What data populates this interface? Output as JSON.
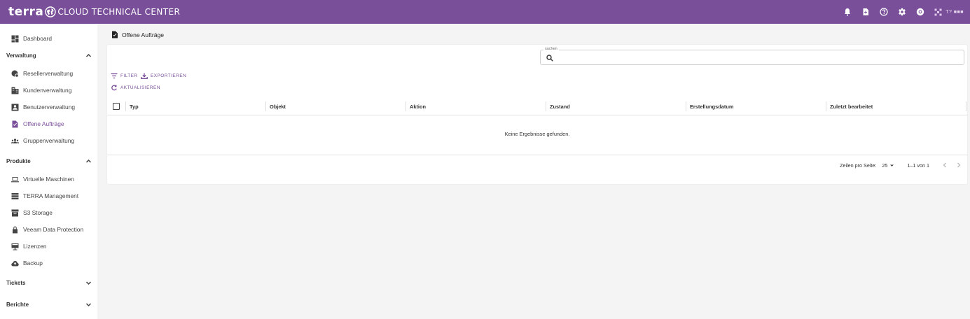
{
  "app": {
    "brand_word": "terra",
    "brand_sub": "CLOUD TECHNICAL CENTER",
    "user_name": "T? ■■■"
  },
  "colors": {
    "accent": "#7a4f9a",
    "background": "#f4f4f4"
  },
  "topbar_icons": [
    "bell-icon",
    "document-icon",
    "help-icon",
    "settings-icon",
    "support-icon",
    "avatar"
  ],
  "sidebar": {
    "dashboard": "Dashboard",
    "verwaltung": {
      "label": "Verwaltung",
      "items": [
        "Resellerverwaltung",
        "Kundenverwaltung",
        "Benutzerverwaltung",
        "Offene Aufträge",
        "Gruppenverwaltung"
      ]
    },
    "produkte": {
      "label": "Produkte",
      "items": [
        "Virtuelle Maschinen",
        "TERRA Management",
        "S3 Storage",
        "Veeam Data Protection",
        "Lizenzen",
        "Backup"
      ]
    },
    "tickets": {
      "label": "Tickets"
    },
    "berichte": {
      "label": "Berichte"
    }
  },
  "main": {
    "title": "Offene Aufträge",
    "search": {
      "legend": "suchen",
      "value": ""
    },
    "toolbar": {
      "filter": "FILTER",
      "export": "EXPORTIEREN",
      "refresh": "AKTUALISIEREN"
    },
    "table": {
      "columns": [
        "Typ",
        "Objekt",
        "Aktion",
        "Zustand",
        "Erstellungsdatum",
        "Zuletzt bearbeitet"
      ],
      "empty": "Keine Ergebnisse gefunden."
    },
    "pagination": {
      "rows_label": "Zeilen pro Seite:",
      "rows_value": "25",
      "range": "1–1 von 1"
    }
  }
}
